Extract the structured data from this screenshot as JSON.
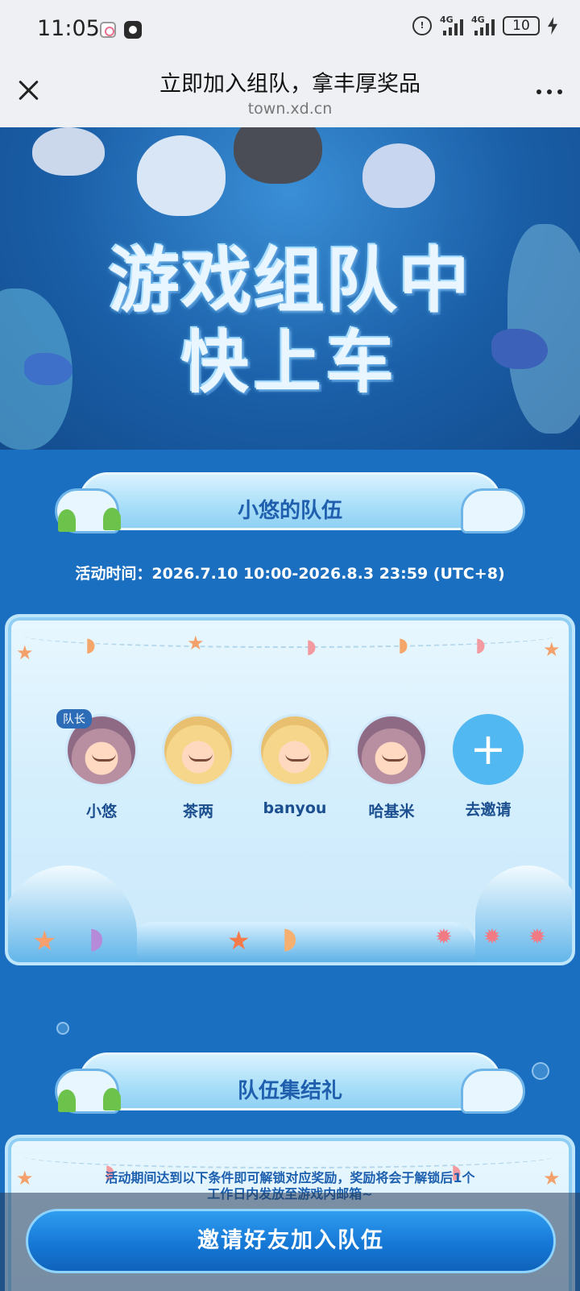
{
  "status_bar": {
    "time": "11:05",
    "network_label": "4G",
    "battery": "10"
  },
  "nav": {
    "title": "立即加入组队，拿丰厚奖品",
    "url": "town.xd.cn"
  },
  "hero": {
    "title_line1": "游戏组队中",
    "title_line2": "快上车"
  },
  "team_section": {
    "heading": "小悠的队伍",
    "activity_time": "活动时间：2026.7.10 10:00-2026.8.3 23:59 (UTC+8)",
    "leader_badge": "队长",
    "members": [
      {
        "name": "小悠",
        "avatar": "granny-avatar"
      },
      {
        "name": "茶两",
        "avatar": "blond-avatar"
      },
      {
        "name": "banyou",
        "avatar": "blond-avatar"
      },
      {
        "name": "哈基米",
        "avatar": "granny-avatar"
      }
    ],
    "invite_label": "去邀请"
  },
  "reward_section": {
    "heading": "队伍集结礼",
    "description": "活动期间达到以下条件即可解锁对应奖励，奖励将会于解锁后1个工作日内发放至游戏内邮箱~"
  },
  "cta": {
    "label": "邀请好友加入队伍"
  },
  "colors": {
    "accent": "#1678d6",
    "heading_text": "#1f5fae",
    "background": "#1a6fc0"
  }
}
